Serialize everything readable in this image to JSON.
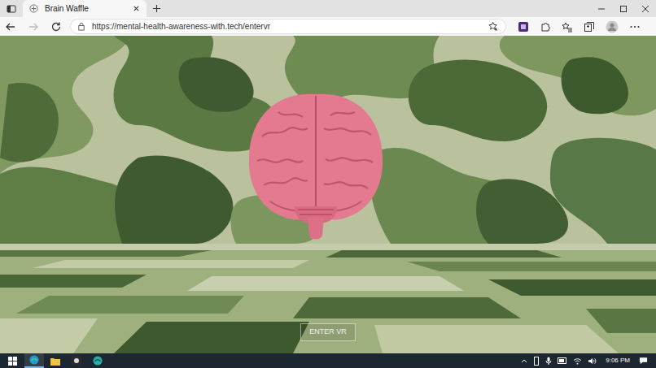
{
  "tabs": [
    {
      "label": "Brain Waffle",
      "selected": true
    }
  ],
  "address_bar": {
    "url": "https://mental-health-awareness-with.tech/entervr"
  },
  "scene": {
    "button": "ENTER VR"
  },
  "taskbar": {
    "time": "9:06 PM"
  }
}
